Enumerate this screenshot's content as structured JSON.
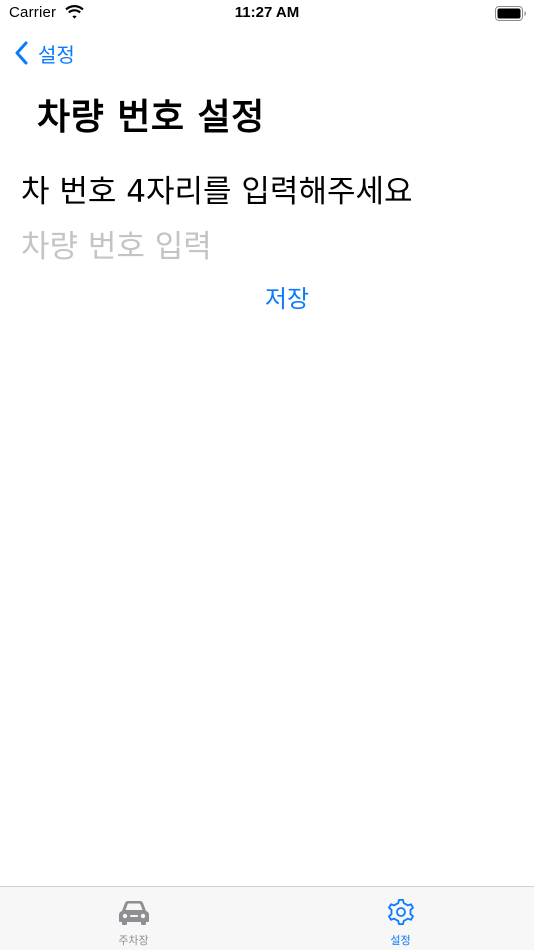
{
  "status_bar": {
    "carrier": "Carrier",
    "time": "11:27 AM",
    "wifi_icon": "wifi-icon",
    "battery_icon": "battery-icon"
  },
  "nav": {
    "back_label": "설정",
    "back_icon": "chevron-left-icon"
  },
  "page": {
    "title": "차량 번호 설정",
    "instruction": "차 번호 4자리를 입력해주세요",
    "input_value": "",
    "input_placeholder": "차량 번호 입력",
    "save_label": "저장"
  },
  "tab_bar": {
    "items": [
      {
        "label": "주차장",
        "icon": "car-icon",
        "active": false
      },
      {
        "label": "설정",
        "icon": "gear-icon",
        "active": true
      }
    ]
  },
  "colors": {
    "accent": "#0a7aff",
    "placeholder": "#c4c4c6",
    "inactive": "#8e8e93",
    "tab_bar_bg": "#f7f7f7"
  }
}
